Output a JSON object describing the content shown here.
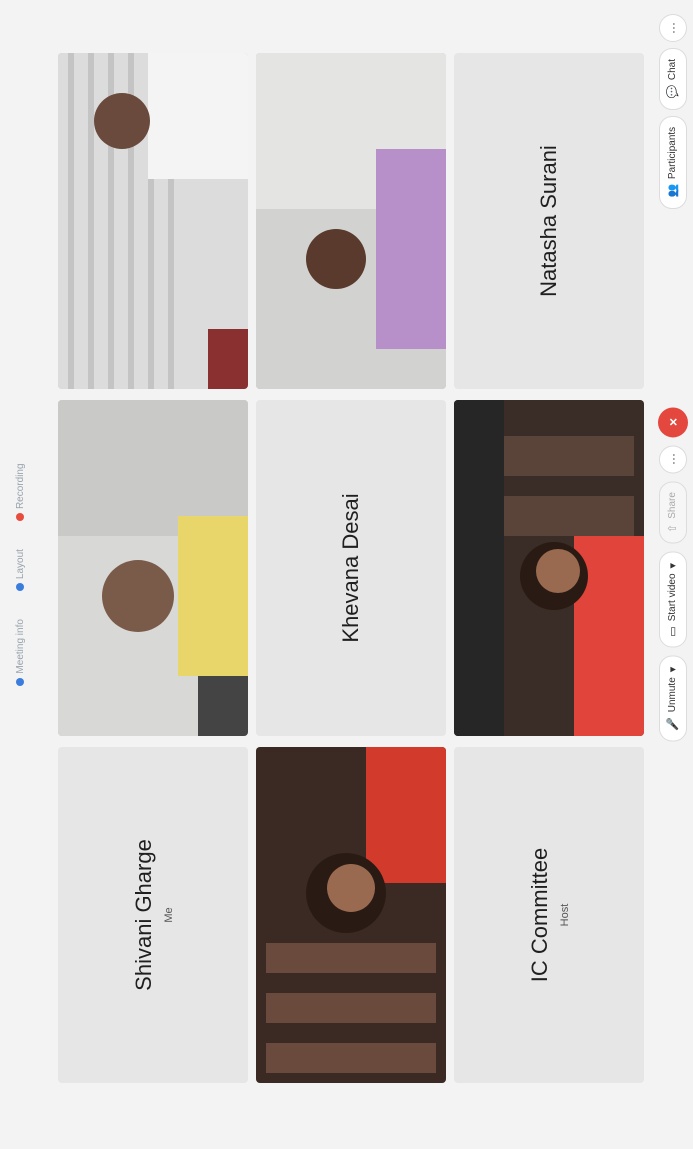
{
  "topbar": {
    "items": [
      "Meeting info",
      "Layout",
      "Recording"
    ]
  },
  "tiles": [
    {
      "type": "name",
      "name": "Shivani Gharge",
      "sub": "Me"
    },
    {
      "type": "video",
      "label": "participant video"
    },
    {
      "type": "video",
      "label": "participant video"
    },
    {
      "type": "video",
      "label": "participant video"
    },
    {
      "type": "name",
      "name": "Khevana Desai",
      "sub": ""
    },
    {
      "type": "video",
      "label": "participant video"
    },
    {
      "type": "name",
      "name": "IC Committee",
      "sub": "Host"
    },
    {
      "type": "video",
      "label": "participant video"
    },
    {
      "type": "name",
      "name": "Natasha Surani",
      "sub": ""
    }
  ],
  "toolbar": {
    "unmute": "Unmute",
    "start_video": "Start video",
    "share": "Share",
    "more": "···",
    "end": "×",
    "participants": "Participants",
    "chat": "Chat",
    "overflow": "···"
  },
  "colors": {
    "end_call": "#e4473d",
    "accent": "#3b7ddd"
  }
}
